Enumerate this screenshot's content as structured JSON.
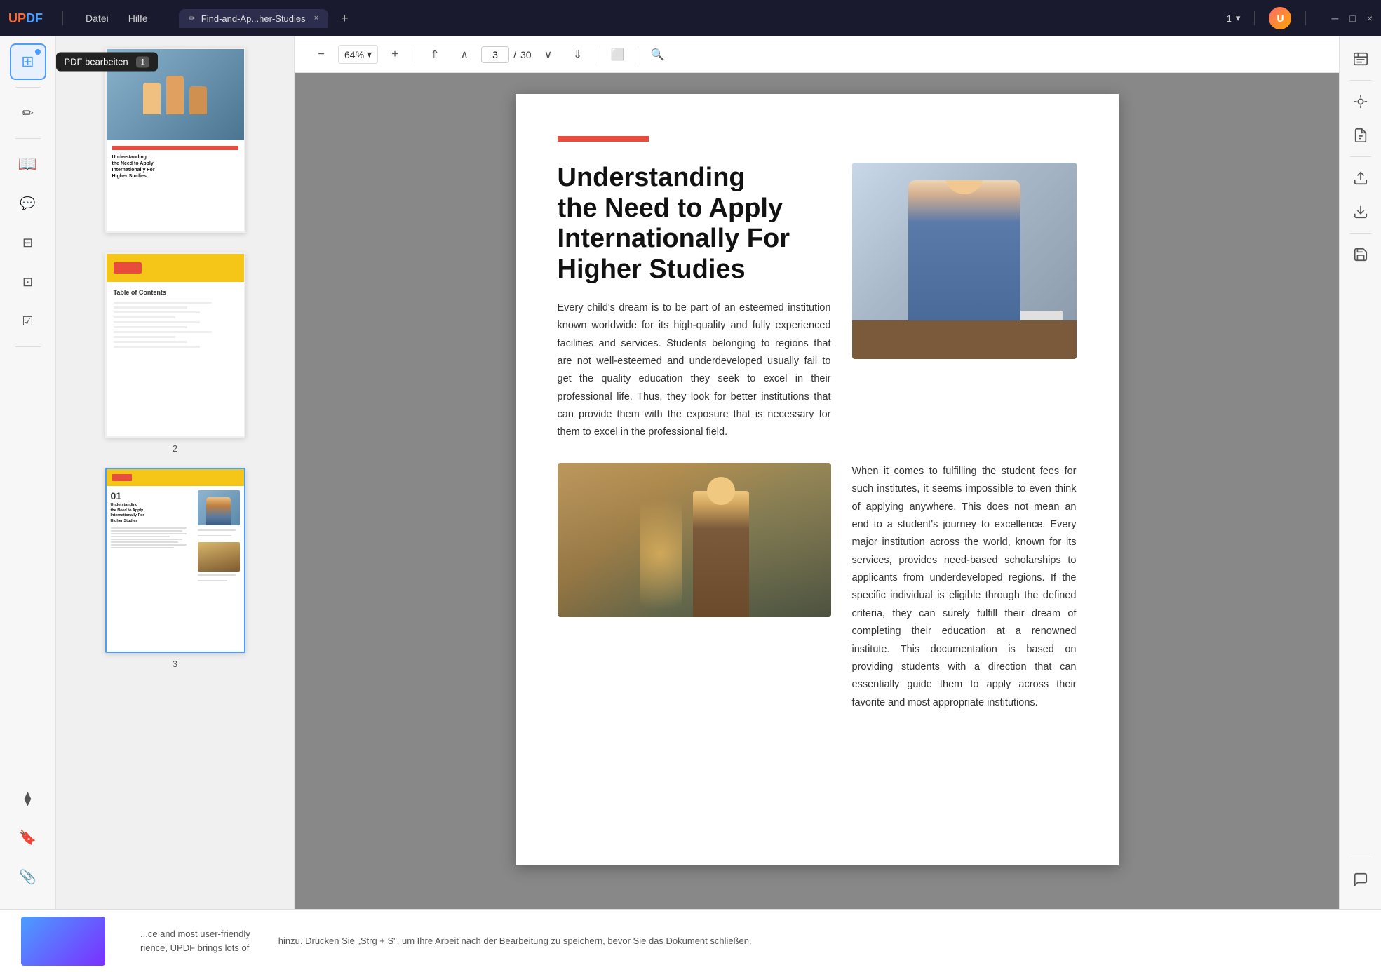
{
  "titlebar": {
    "logo": "UPDF",
    "menu_datei": "Datei",
    "menu_hilfe": "Hilfe",
    "tab_title": "Find-and-Ap...her-Studies",
    "tab_close": "×",
    "tab_add": "+",
    "page_nav": "1",
    "win_min": "─",
    "win_max": "□",
    "win_close": "×"
  },
  "toolbar": {
    "zoom_out": "−",
    "zoom_level": "64%",
    "zoom_dropdown": "▾",
    "zoom_in": "+",
    "nav_first": "⇑",
    "nav_prev": "∧",
    "page_current": "3",
    "page_separator": "/",
    "page_total": "30",
    "nav_next": "∨",
    "nav_last": "⇓",
    "present_icon": "⬜",
    "search_icon": "🔍"
  },
  "thumbnail_panel": {
    "page1_label": "",
    "page2_label": "2",
    "page3_label": "3",
    "toc_title": "Table of Contents",
    "toc_line1": "Understanding Need to Apply Internationally For Higher Studies",
    "toc_line2": "The Most Global Institutions Leading to Better Education",
    "toc_line3": "Looking Into the Top 10 Subject Majors That Feature the Most Professional Exposure",
    "toc_line4": "Scholarship Rules - How to Apply For One in Your Favourite Institution",
    "toc_line5": "Scholarship Rules for the 10 Best Global Universities You Must Consider",
    "toc_line6": "Practical Tips to Help You in Applying for University Scholarships",
    "toc_line7": "Reviewing the Application Period and Other Release Period of Famous Institutions",
    "toc_line8": "Famous Institutions in North American Countries",
    "toc_line9": "Famous Institutions in Europe",
    "toc_line10": "UPDF - The Perfect Solution to Prepare Scholarship Applications for Students"
  },
  "sidebar": {
    "tooltip_label": "PDF bearbeiten",
    "tooltip_badge": "1",
    "icons": [
      {
        "name": "thumbnails-icon",
        "label": "Thumbnails"
      },
      {
        "name": "edit-pdf-icon",
        "label": "PDF bearbeiten"
      },
      {
        "name": "read-icon",
        "label": "Read"
      },
      {
        "name": "annotate-icon",
        "label": "Annotate"
      },
      {
        "name": "organize-icon",
        "label": "Organize"
      },
      {
        "name": "export-icon",
        "label": "Export"
      },
      {
        "name": "form-icon",
        "label": "Form"
      },
      {
        "name": "layers-icon",
        "label": "Layers"
      },
      {
        "name": "bookmark-icon",
        "label": "Bookmark"
      },
      {
        "name": "attachment-icon",
        "label": "Attachment"
      }
    ]
  },
  "pdf_page": {
    "title_line1": "Understanding",
    "title_line2": "the Need to Apply",
    "title_line3": "Internationally For",
    "title_line4": "Higher Studies",
    "body_text_1": "Every child's dream is to be part of an esteemed institution known worldwide for its high-quality and fully experienced facilities and services. Students belonging to regions that are not well-esteemed and underdeveloped usually fail to get the quality education they seek to excel in their professional life. Thus, they look for better institutions that can provide them with the exposure that is necessary for them to excel in the professional field.",
    "body_text_2": "When it comes to fulfilling the student fees for such institutes, it seems impossible to even think of applying anywhere. This does not mean an end to a student's journey to excellence. Every major institution across the world, known for its services, provides need-based scholarships to applicants from underdeveloped regions. If the specific individual is eligible through the defined criteria, they can surely fulfill their dream of completing their education at a renowned institute. This documentation is based on providing students with a direction that can essentially guide them to apply across their favorite and most appropriate institutions."
  },
  "right_panel": {
    "icons": [
      {
        "name": "ocr-icon",
        "label": "OCR"
      },
      {
        "name": "scan-icon",
        "label": "Scan"
      },
      {
        "name": "extract-icon",
        "label": "Extract"
      },
      {
        "name": "upload-icon",
        "label": "Upload"
      },
      {
        "name": "download-icon",
        "label": "Download"
      },
      {
        "name": "save-icon",
        "label": "Save"
      },
      {
        "name": "chat-icon",
        "label": "Chat"
      }
    ]
  },
  "bottom_bar": {
    "left_text": "...ce and most user-friendly\nrience, UPDF brings lots of",
    "right_text": "hinzu. Drucken Sie „Strg + S\", um Ihre Arbeit nach der Bearbeitung\nzu speichern, bevor Sie das Dokument schließen."
  }
}
